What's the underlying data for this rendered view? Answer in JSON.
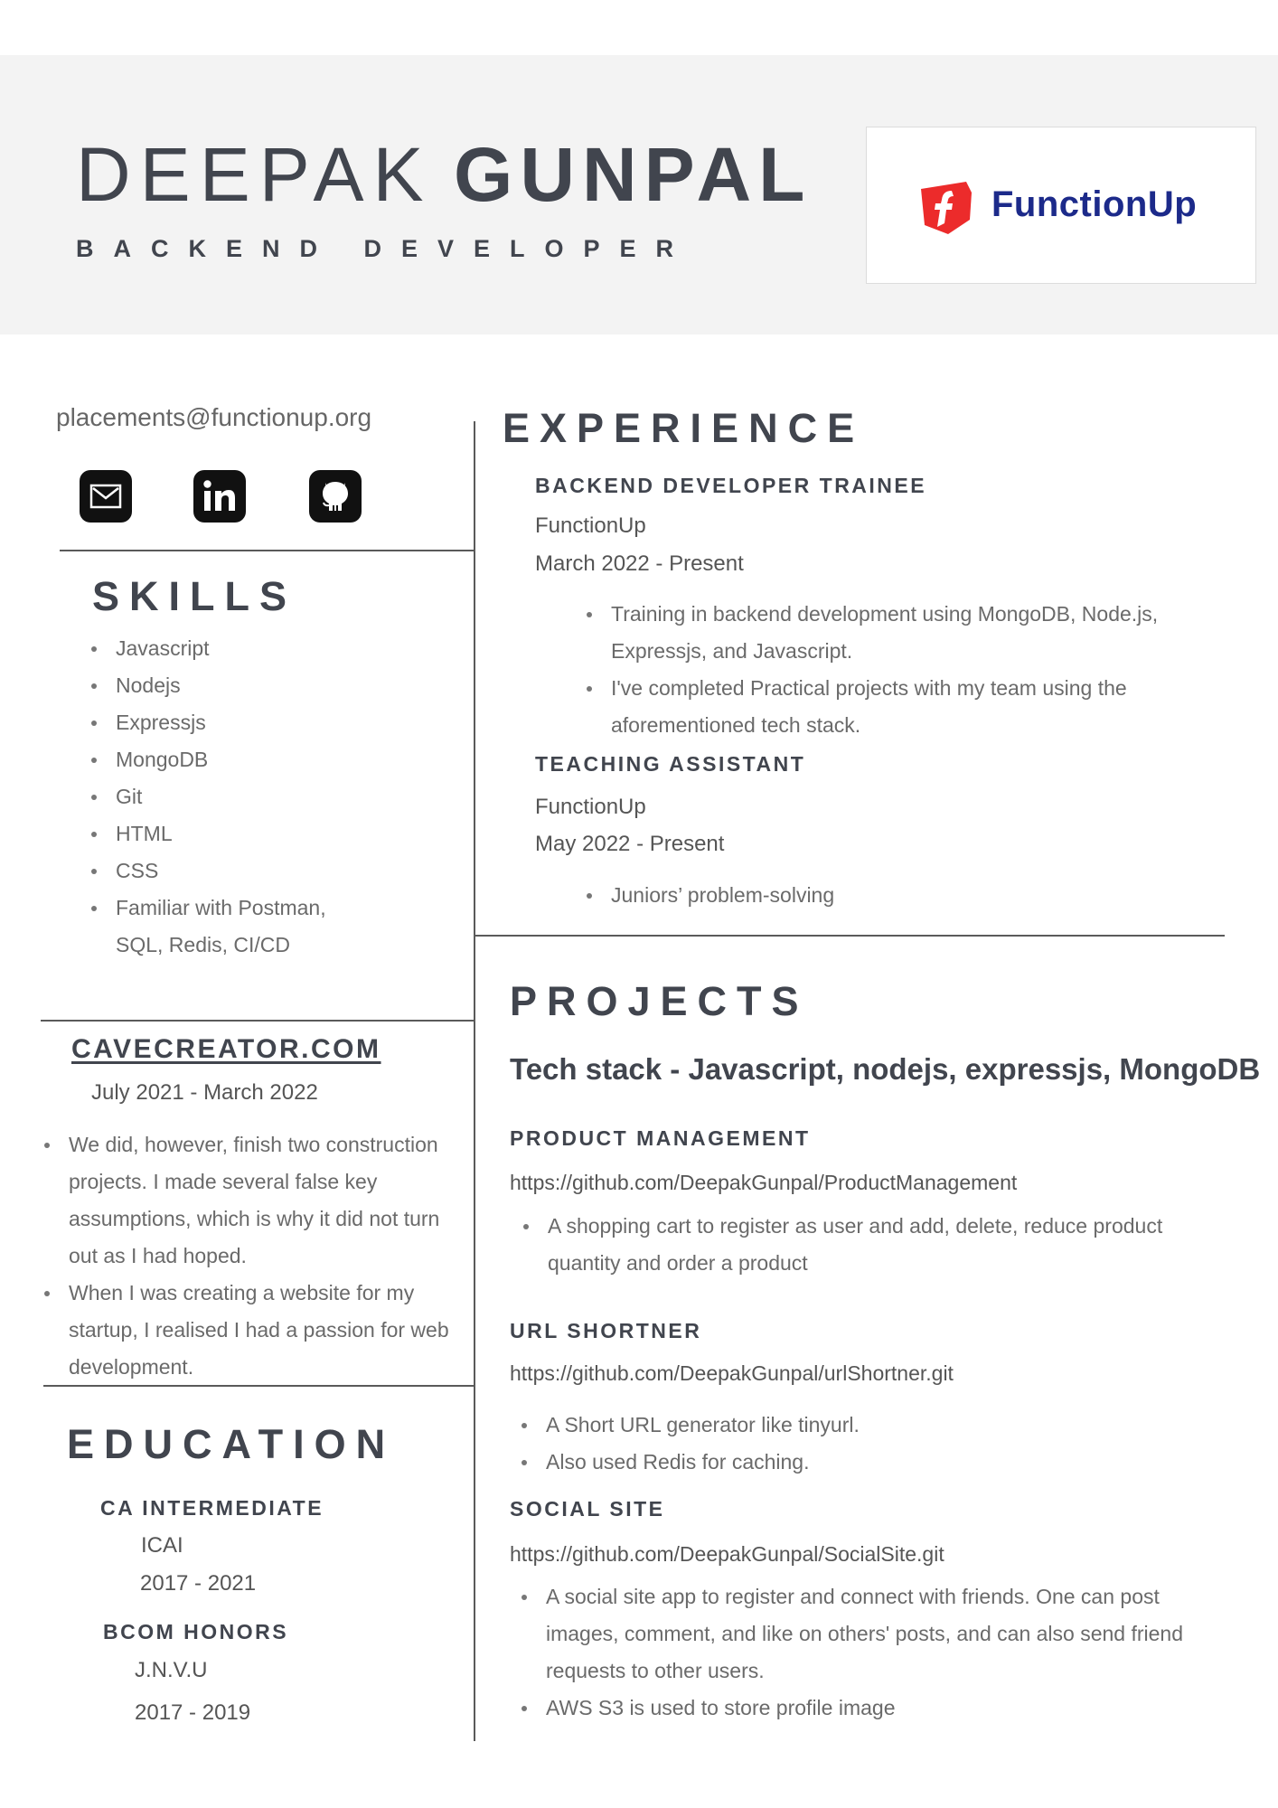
{
  "header": {
    "first_name": "DEEPAK",
    "last_name": "GUNPAL",
    "job_title": "BACKEND DEVELOPER",
    "logo_text": "FunctionUp"
  },
  "contact": {
    "email": "placements@functionup.org",
    "icons": [
      "mail-icon",
      "linkedin-icon",
      "github-icon"
    ]
  },
  "skills": {
    "title": "SKILLS",
    "items": [
      "Javascript",
      "Nodejs",
      "Expressjs",
      "MongoDB",
      "Git",
      "HTML",
      "CSS",
      "Familiar with Postman,",
      "SQL, Redis, CI/CD"
    ]
  },
  "cavecreator": {
    "title": "CAVECREATOR.COM",
    "dates": "July 2021 - March 2022",
    "bullets": [
      "We did, however, finish two construction projects. I made several false key assumptions, which is why it did not turn out as I had hoped.",
      "When I was creating a website for my startup, I realised I had a passion for web development."
    ]
  },
  "education": {
    "title": "EDUCATION",
    "entries": [
      {
        "degree": "CA INTERMEDIATE",
        "institution": "ICAI",
        "years": "2017 - 2021"
      },
      {
        "degree": "BCOM HONORS",
        "institution": "J.N.V.U",
        "years": "2017 - 2019"
      }
    ]
  },
  "experience": {
    "title": "EXPERIENCE",
    "roles": [
      {
        "role": "BACKEND DEVELOPER TRAINEE",
        "company": "FunctionUp",
        "dates": "March 2022 - Present",
        "bullets": [
          "Training in backend development using MongoDB, Node.js, Expressjs, and Javascript.",
          " I've completed Practical projects with my team using the aforementioned tech stack."
        ]
      },
      {
        "role": "TEACHING ASSISTANT",
        "company": "FunctionUp",
        "dates": "May 2022 - Present",
        "bullets": [
          "Juniors’ problem-solving"
        ]
      }
    ]
  },
  "projects": {
    "title": "PROJECTS",
    "tech_stack": "Tech stack - Javascript, nodejs, expressjs, MongoDB",
    "items": [
      {
        "name": "PRODUCT MANAGEMENT",
        "url": "https://github.com/DeepakGunpal/ProductManagement",
        "bullets": [
          "A shopping cart to register as user and add, delete, reduce product quantity and order a product"
        ]
      },
      {
        "name": "URL SHORTNER",
        "url": "https://github.com/DeepakGunpal/urlShortner.git",
        "bullets": [
          " A Short URL generator like tinyurl.",
          "Also used Redis for caching."
        ]
      },
      {
        "name": "SOCIAL SITE",
        "url": "https://github.com/DeepakGunpal/SocialSite.git",
        "bullets": [
          "A social site app to register and connect with friends. One can post images, comment, and like on others' posts, and can also send friend requests to other users.",
          "AWS S3 is used to store profile image"
        ]
      }
    ]
  },
  "colors": {
    "heading": "#41454e",
    "header_band": "#f3f3f3",
    "logo_red": "#ec2b2b",
    "logo_blue": "#1c2a8a"
  }
}
